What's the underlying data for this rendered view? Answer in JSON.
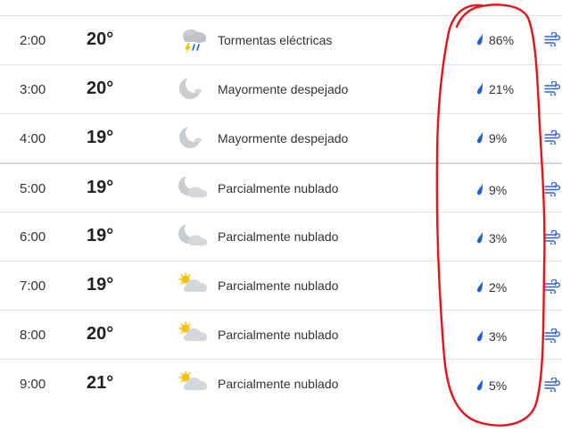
{
  "hourly": [
    {
      "time": "2:00",
      "temp": "20°",
      "icon": "thunderstorm-icon",
      "condition": "Tormentas eléctricas",
      "precip": "86%"
    },
    {
      "time": "3:00",
      "temp": "20°",
      "icon": "moon-clear-icon",
      "condition": "Mayormente despejado",
      "precip": "21%"
    },
    {
      "time": "4:00",
      "temp": "19°",
      "icon": "moon-clear-icon",
      "condition": "Mayormente despejado",
      "precip": "9%"
    },
    {
      "time": "5:00",
      "temp": "19°",
      "icon": "moon-cloud-icon",
      "condition": "Parcialmente nublado",
      "precip": "9%"
    },
    {
      "time": "6:00",
      "temp": "19°",
      "icon": "moon-cloud-icon",
      "condition": "Parcialmente nublado",
      "precip": "3%"
    },
    {
      "time": "7:00",
      "temp": "19°",
      "icon": "sun-cloud-icon",
      "condition": "Parcialmente nublado",
      "precip": "2%"
    },
    {
      "time": "8:00",
      "temp": "20°",
      "icon": "sun-cloud-icon",
      "condition": "Parcialmente nublado",
      "precip": "3%"
    },
    {
      "time": "9:00",
      "temp": "21°",
      "icon": "sun-cloud-icon",
      "condition": "Parcialmente nublado",
      "precip": "5%"
    }
  ],
  "colors": {
    "drop": "#1f5fd6",
    "wind": "#2c63d9",
    "annotation": "#e8121a",
    "divider": "#e3e3e3"
  }
}
